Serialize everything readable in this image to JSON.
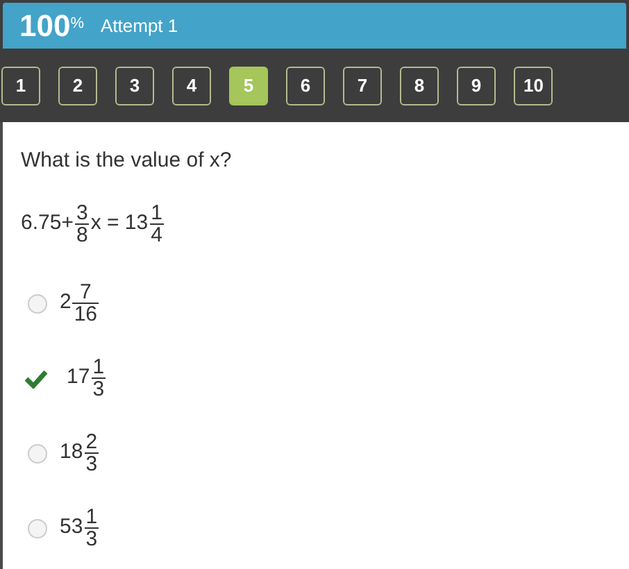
{
  "header": {
    "score": "100$^{%}$",
    "attempt": "Attempt 1"
  },
  "question_nav": [
    {
      "label": "1",
      "selected": false
    },
    {
      "label": "2",
      "selected": false
    },
    {
      "label": "3",
      "selected": false
    },
    {
      "label": "4",
      "selected": false
    },
    {
      "label": "5",
      "selected": true
    },
    {
      "label": "6",
      "selected": false
    },
    {
      "label": "7",
      "selected": false
    },
    {
      "label": "8",
      "selected": false
    },
    {
      "label": "9",
      "selected": false
    },
    {
      "label": "10",
      "selected": false
    }
  ],
  "question": "What is the value of x?",
  "equation": [
    {
      "kind": "text",
      "text": "6.75+"
    },
    {
      "kind": "fraction",
      "numerator": "3",
      "denominator": "8"
    },
    {
      "kind": "text",
      "text": "x = 13"
    },
    {
      "kind": "fraction",
      "numerator": "1",
      "denominator": "4"
    }
  ],
  "options": [
    {
      "whole": "2",
      "numerator": "7",
      "denominator": "16",
      "selected": false
    },
    {
      "whole": "17",
      "numerator": "1",
      "denominator": "3",
      "selected": true
    },
    {
      "whole": "18",
      "numerator": "2",
      "denominator": "3",
      "selected": false
    },
    {
      "whole": "53",
      "numerator": "1",
      "denominator": "3",
      "selected": false
    }
  ]
}
